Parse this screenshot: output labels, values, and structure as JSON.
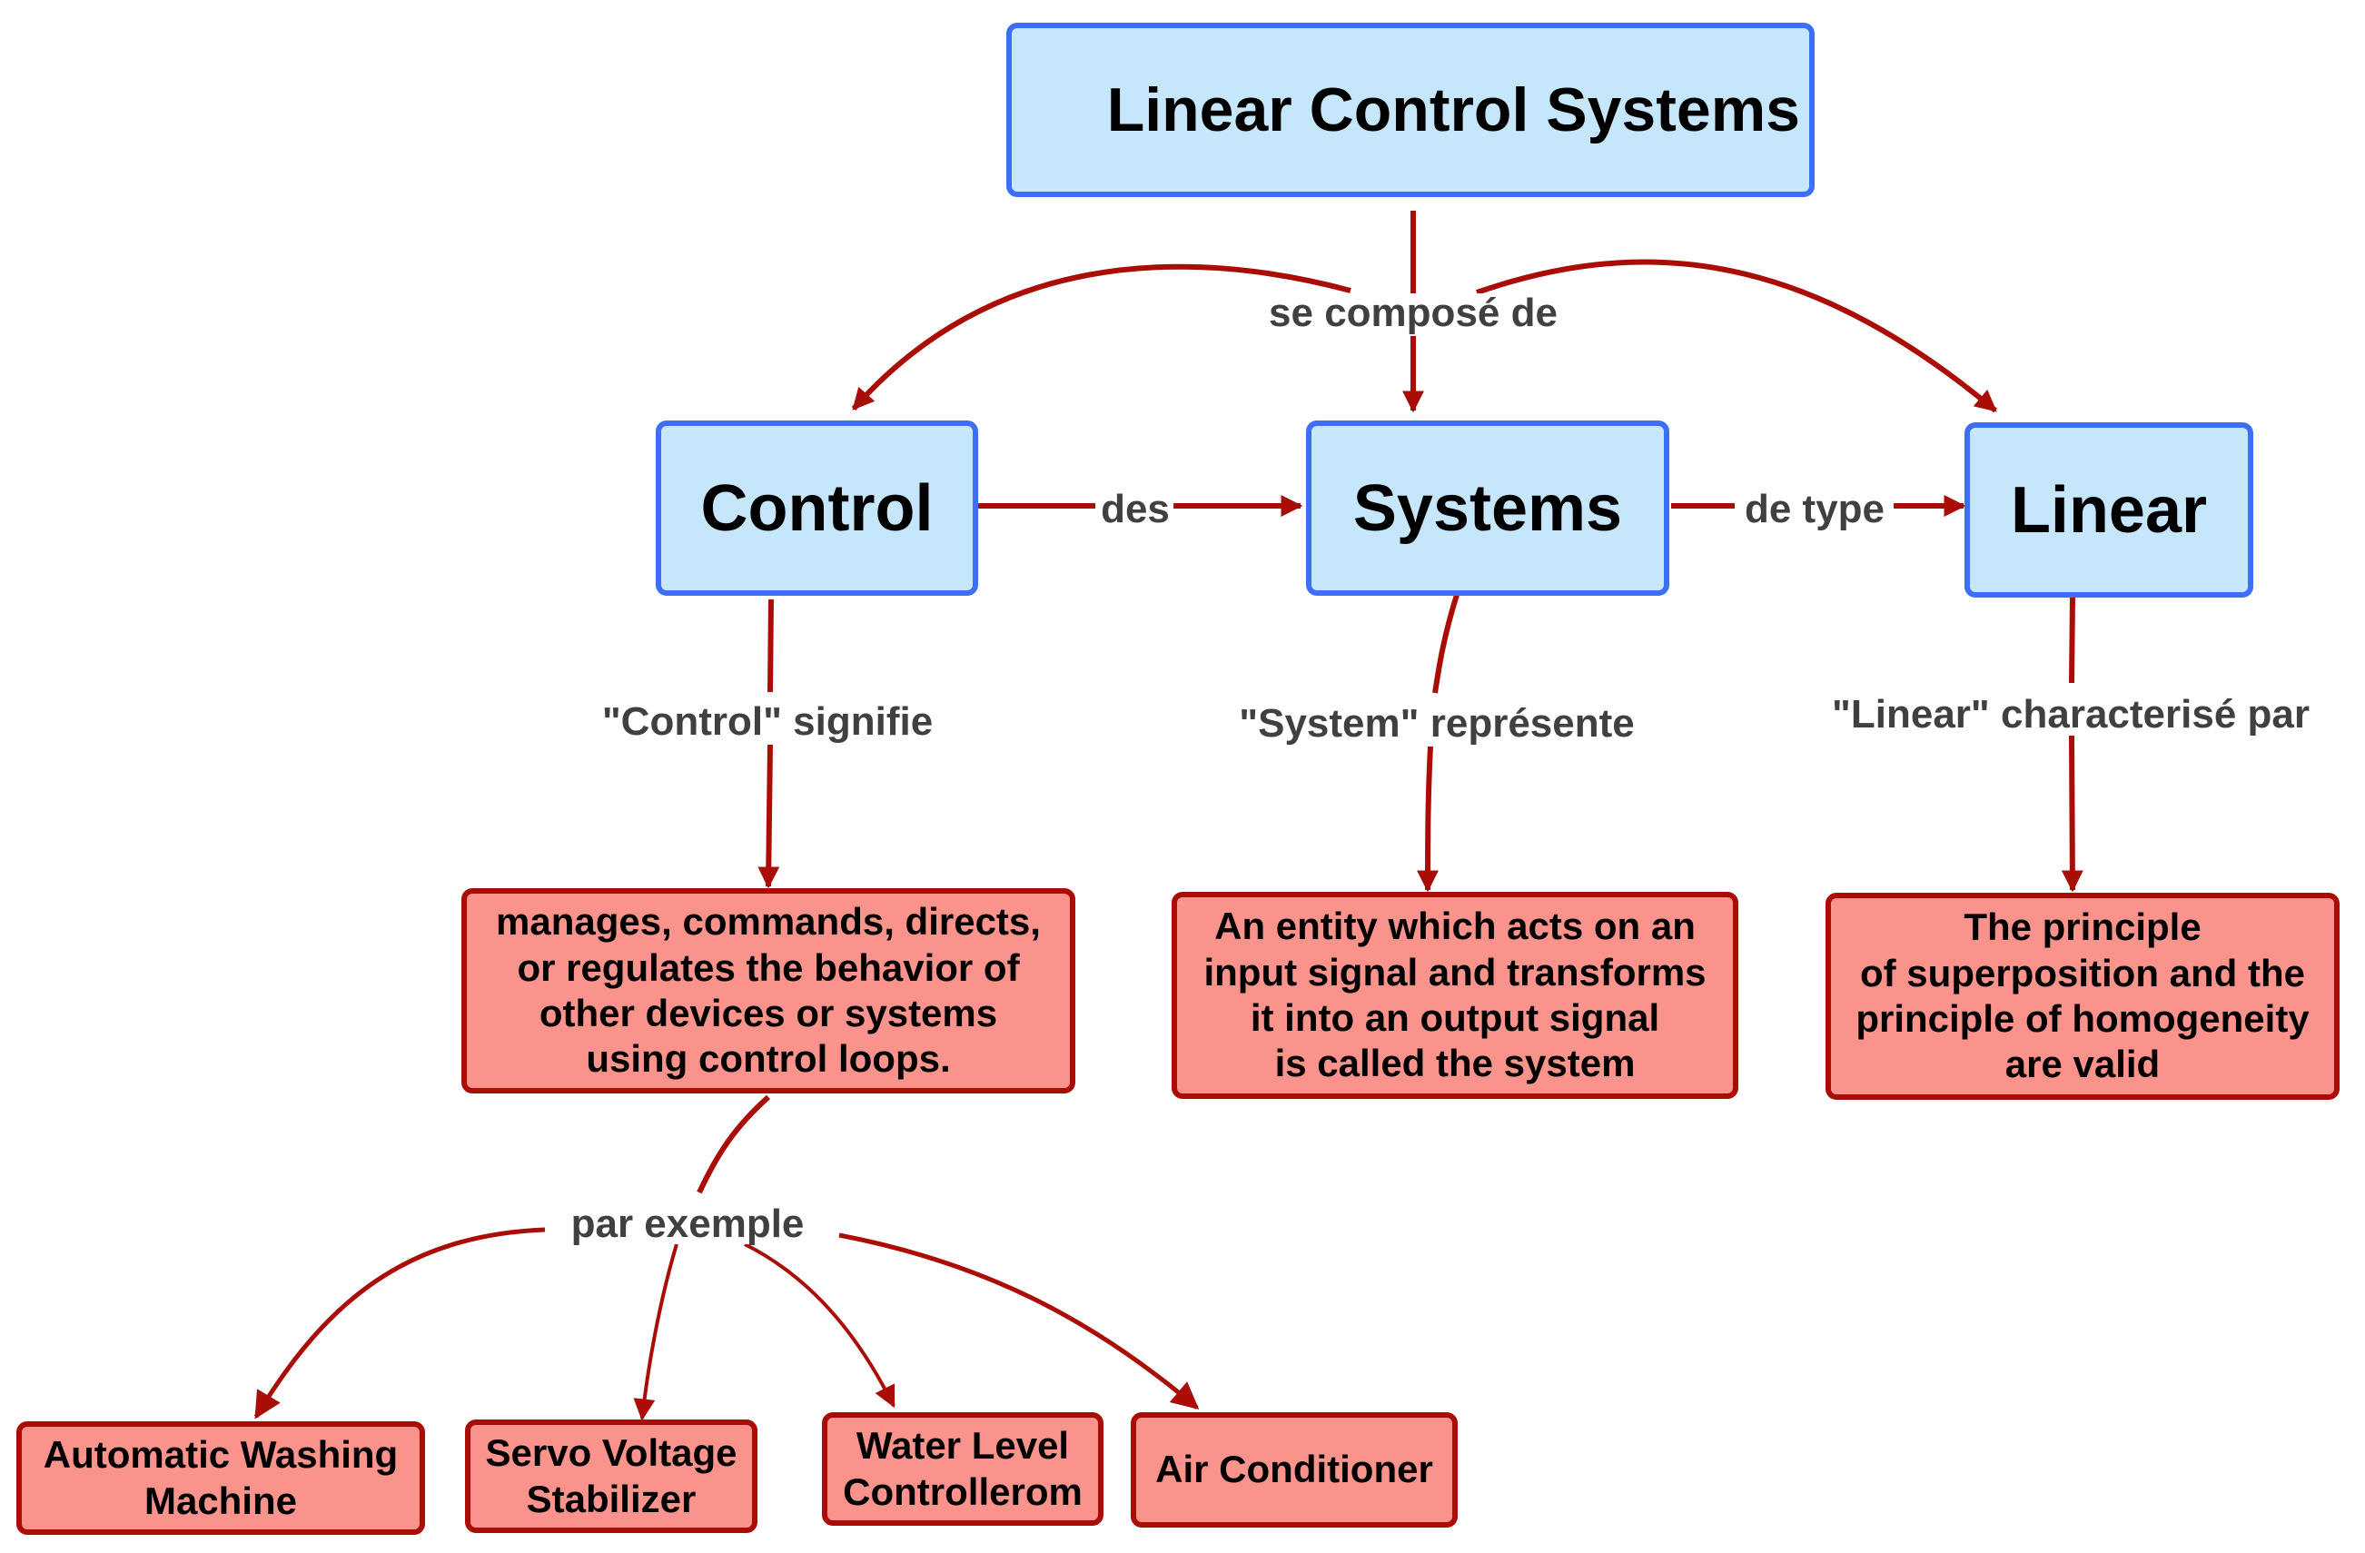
{
  "diagram": {
    "type": "concept-map",
    "colors": {
      "concept_fill": "#c5e6fb",
      "concept_border": "#3d6ef5",
      "leaf_fill": "#fa938c",
      "leaf_border": "#a90d05",
      "edge": "#a90d05",
      "link_text": "#404040",
      "node_text": "#000000"
    },
    "nodes": {
      "root": {
        "label": "Linear Control Systems"
      },
      "control": {
        "label": "Control"
      },
      "systems": {
        "label": "Systems"
      },
      "linear": {
        "label": "Linear"
      },
      "control_def": {
        "label": "manages, commands, directs,\nor regulates the behavior of\nother devices or systems\nusing control loops."
      },
      "system_def": {
        "label": "An entity which acts on an\ninput signal and transforms\nit into an output signal\nis called the system"
      },
      "linear_def": {
        "label": "The principle\nof superposition and the\nprinciple of homogeneity\nare valid"
      },
      "ex_washing": {
        "label": "Automatic Washing\nMachine"
      },
      "ex_servo": {
        "label": "Servo Voltage\nStabilizer"
      },
      "ex_water": {
        "label": "Water Level\nControllerom"
      },
      "ex_ac": {
        "label": "Air Conditioner"
      }
    },
    "links": {
      "compose": {
        "label": "se composé de",
        "from": "root",
        "to": [
          "control",
          "systems",
          "linear"
        ]
      },
      "des": {
        "label": "des",
        "from": "control",
        "to": [
          "systems"
        ]
      },
      "de_type": {
        "label": "de type",
        "from": "systems",
        "to": [
          "linear"
        ]
      },
      "control_means": {
        "label": "\"Control\" signifie",
        "from": "control",
        "to": [
          "control_def"
        ]
      },
      "system_represents": {
        "label": "\"System\" représente",
        "from": "systems",
        "to": [
          "system_def"
        ]
      },
      "linear_char": {
        "label": "\"Linear\" characterisé par",
        "from": "linear",
        "to": [
          "linear_def"
        ]
      },
      "examples": {
        "label": "par exemple",
        "from": "control_def",
        "to": [
          "ex_washing",
          "ex_servo",
          "ex_water",
          "ex_ac"
        ]
      }
    }
  }
}
